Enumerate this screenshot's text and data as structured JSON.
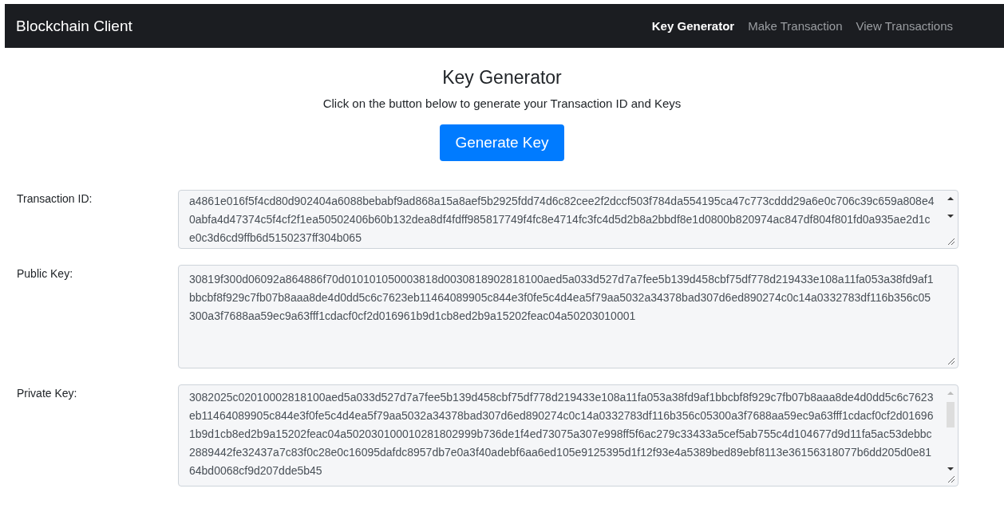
{
  "navbar": {
    "brand": "Blockchain Client",
    "links": [
      {
        "label": "Key Generator",
        "selected": true
      },
      {
        "label": "Make Transaction",
        "selected": false
      },
      {
        "label": "View Transactions",
        "selected": false
      }
    ]
  },
  "heading": "Key Generator",
  "subtitle": "Click on the button below to generate your Transaction ID and Keys",
  "button": "Generate Key",
  "fields": [
    {
      "label": "Transaction ID:",
      "kind": "scrollable",
      "value": "a4861e016f5f4cd80d902404a6088bebabf9ad868a15a8aef5b2925fdd74d6c82cee2f2dccf503f784da554195ca47c773cddd29a6e0c706c39c659a808e40abfa4d47374c5f4cf2f1ea50502406b60b132dea8df4fdff985817749f4fc8e4714fc3fc4d5d2b8a2bbdf8e1d0800b820974ac847df804f801fd0a935ae2d1ce0c3d6cd9ffb6d5150237ff304b065"
    },
    {
      "label": "Public Key:",
      "kind": "plain",
      "value": "30819f300d06092a864886f70d010101050003818d0030818902818100aed5a033d527d7a7fee5b139d458cbf75df778d219433e108a11fa053a38fd9af1bbcbf8f929c7fb07b8aaa8de4d0dd5c6c7623eb11464089905c844e3f0fe5c4d4ea5f79aa5032a34378bad307d6ed890274c0c14a0332783df116b356c05300a3f7688aa59ec9a63fff1cdacf0cf2d016961b9d1cb8ed2b9a15202feac04a50203010001"
    },
    {
      "label": "Private Key:",
      "kind": "scrolled",
      "value": "3082025c02010002818100aed5a033d527d7a7fee5b139d458cbf75df778d219433e108a11fa053a38fd9af1bbcbf8f929c7fb07b8aaa8de4d0dd5c6c7623eb11464089905c844e3f0fe5c4d4ea5f79aa5032a34378bad307d6ed890274c0c14a0332783df116b356c05300a3f7688aa59ec9a63fff1cdacf0cf2d016961b9d1cb8ed2b9a15202feac04a502030100010281802999b736de1f4ed73075a307e998ff5f6ac279c33433a5cef5ab755c4d104677d9d11fa5ac53debbc2889442fe32437a7c83f0c28e0c16095dafdc8957db7e0a3f40adebf6aa6ed105e9125395d1f12f93e4a5389bed89ebf8113e36156318077b6dd205d0e8164bd0068cf9d207dde5b45"
    }
  ]
}
